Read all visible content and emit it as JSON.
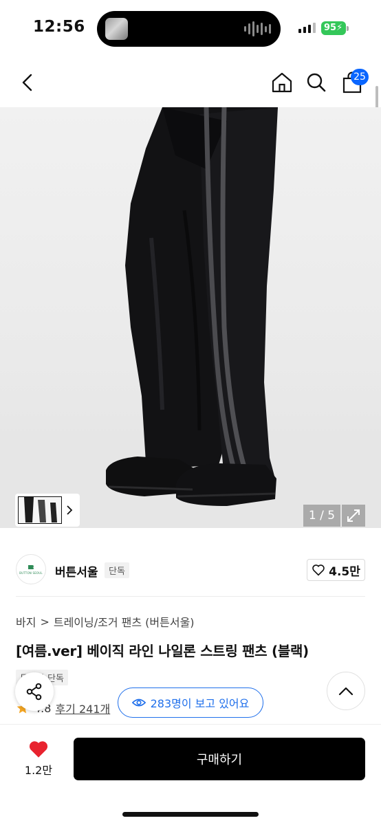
{
  "status_bar": {
    "time": "12:56",
    "battery": "95"
  },
  "header": {
    "cart_count": "25"
  },
  "gallery": {
    "counter": "1 / 5"
  },
  "brand": {
    "logo_text": "BUTTON SEOUL",
    "name": "버튼서울",
    "tag": "단독",
    "likes": "4.5만"
  },
  "breadcrumb": {
    "category": "바지",
    "separator": ">",
    "subcategory": "트레이닝/조거 팬츠 (버튼서울)"
  },
  "product": {
    "title": "[여름.ver] 베이직 라인 나일론 스트링 팬츠 (블랙)",
    "tag": "무신사 단독",
    "rating": "4.8",
    "reviews": "후기 241개",
    "viewers": "283명이 보고 있어요"
  },
  "bottom_bar": {
    "wish_count": "1.2만",
    "buy_label": "구매하기"
  },
  "colors": {
    "accent_blue": "#1f6feb",
    "badge_blue": "#0a66ff",
    "heart_red": "#e8232f",
    "battery_green": "#34c759",
    "buy_button": "#000000"
  },
  "icons": [
    "back-arrow-icon",
    "home-icon",
    "search-icon",
    "shopping-bag-icon",
    "chevron-right-icon",
    "expand-icon",
    "heart-outline-icon",
    "star-icon",
    "eye-icon",
    "share-icon",
    "chevron-up-icon",
    "heart-filled-icon"
  ]
}
